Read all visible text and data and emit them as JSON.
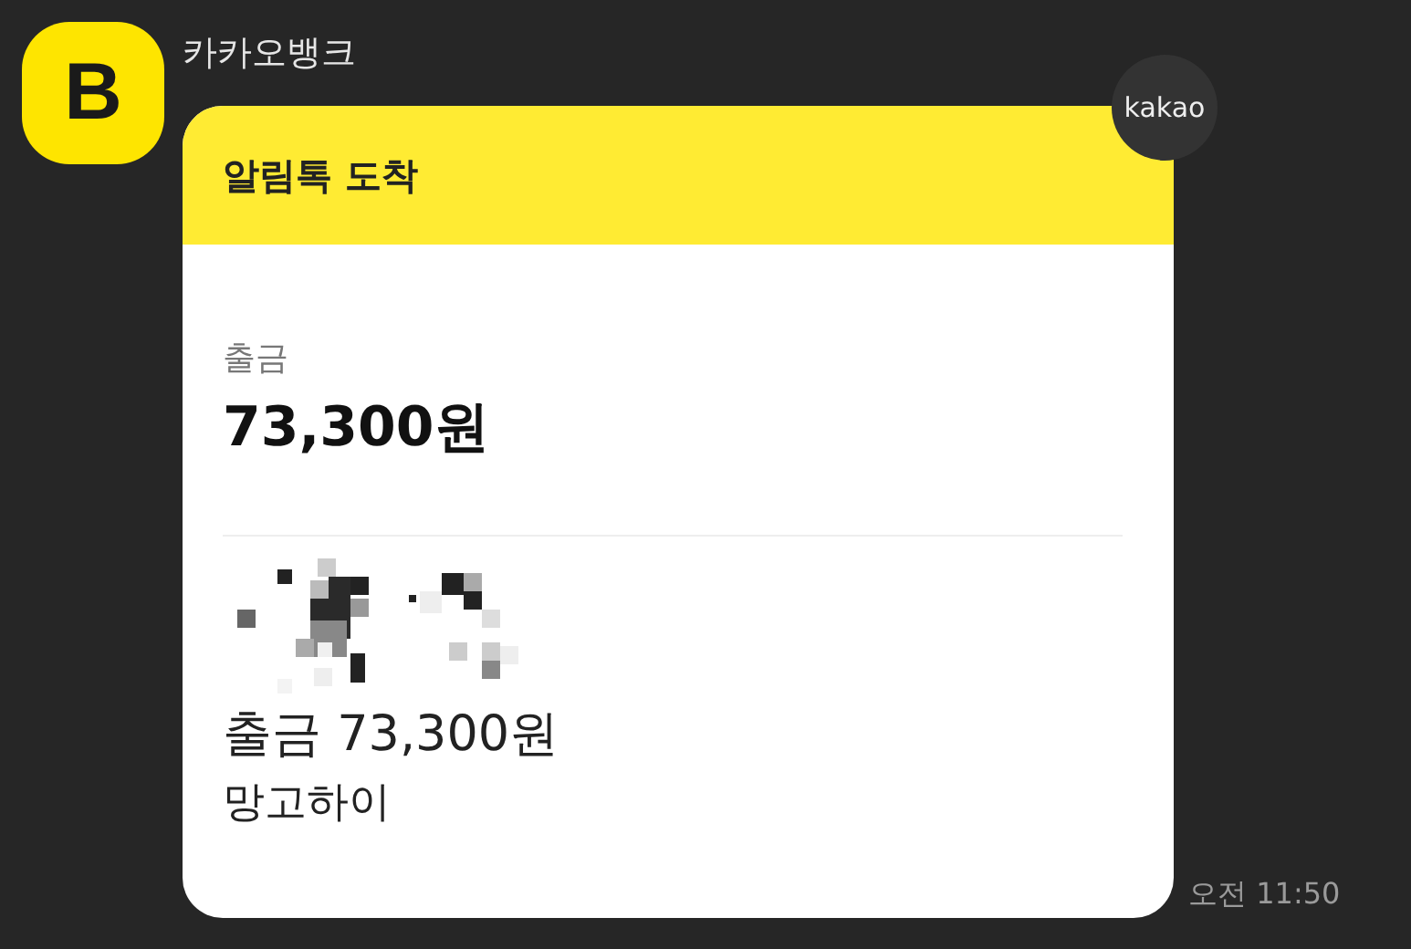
{
  "sender": {
    "name": "카카오뱅크",
    "avatar_letter": "B"
  },
  "message": {
    "badge": "kakao",
    "header": "알림톡 도착",
    "label": "출금",
    "amount": "73,300원",
    "summary": "출금 73,300원",
    "merchant": "망고하이",
    "time": "오전 11:50"
  }
}
